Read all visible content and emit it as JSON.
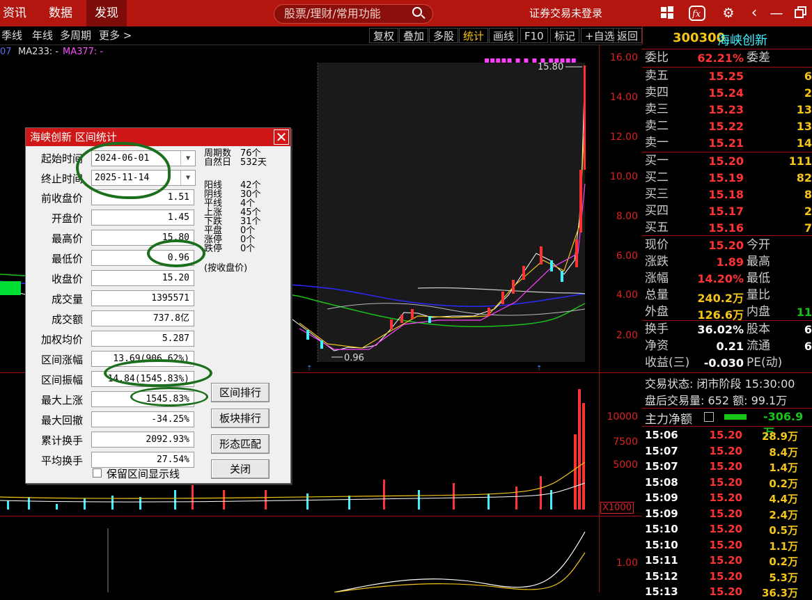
{
  "topbar": {
    "menus": [
      "资讯",
      "数据",
      "发现"
    ],
    "search_placeholder": "股票/理财/常用功能",
    "login_status": "证券交易未登录",
    "icons": [
      "windows-icon",
      "fx-icon",
      "gear-icon",
      "back-icon",
      "minimize-icon",
      "restore-icon"
    ]
  },
  "toolbar": {
    "periods": [
      "季线",
      "年线",
      "多周期",
      "更多 >"
    ],
    "buttons": [
      "复权",
      "叠加",
      "多股",
      "统计",
      "画线",
      "F10",
      "标记",
      "+自选",
      "返回"
    ],
    "ma_legend": [
      "07",
      "MA233: -",
      "MA377: -"
    ]
  },
  "chart": {
    "price_axis": [
      "16.00",
      "14.00",
      "12.00",
      "10.00",
      "8.00",
      "6.00",
      "4.00",
      "2.00"
    ],
    "high_label": "15.80",
    "low_label": "0.96",
    "volume_axis": [
      "10000",
      "7500",
      "5000"
    ],
    "volume_unit": "X1000",
    "indicator_axis": [
      "1.00"
    ]
  },
  "dialog": {
    "title": "海峡创新 区间统计",
    "start_label": "起始时间",
    "start_value": "2024-06-01",
    "end_label": "终止时间",
    "end_value": "2025-11-14",
    "rows": [
      {
        "label": "前收盘价",
        "value": "1.51"
      },
      {
        "label": "开盘价",
        "value": "1.45"
      },
      {
        "label": "最高价",
        "value": "15.80"
      },
      {
        "label": "最低价",
        "value": "0.96"
      },
      {
        "label": "收盘价",
        "value": "15.20"
      },
      {
        "label": "成交量",
        "value": "1395571"
      },
      {
        "label": "成交额",
        "value": "737.8亿"
      },
      {
        "label": "加权均价",
        "value": "5.287"
      },
      {
        "label": "区间涨幅",
        "value": "13.69(906.62%)"
      },
      {
        "label": "区间振幅",
        "value": "14.84(1545.83%)"
      },
      {
        "label": "最大上涨",
        "value": "1545.83%"
      },
      {
        "label": "最大回撤",
        "value": "-34.25%"
      },
      {
        "label": "累计换手",
        "value": "2092.93%"
      },
      {
        "label": "平均换手",
        "value": "27.54%"
      }
    ],
    "stats": [
      {
        "k": "周期数",
        "v": "76个"
      },
      {
        "k": "自然日",
        "v": "532天"
      },
      {
        "k": "阳线",
        "v": "42个"
      },
      {
        "k": "阴线",
        "v": "30个"
      },
      {
        "k": "平线",
        "v": "4个"
      },
      {
        "k": "上涨",
        "v": "45个"
      },
      {
        "k": "下跌",
        "v": "31个"
      },
      {
        "k": "平盘",
        "v": "0个"
      },
      {
        "k": "涨停",
        "v": "0个"
      },
      {
        "k": "跌停",
        "v": "0个"
      }
    ],
    "stats_note": "(按收盘价)",
    "buttons": [
      "区间排行",
      "板块排行",
      "形态匹配",
      "关闭"
    ],
    "checkbox_label": "保留区间显示线"
  },
  "quote": {
    "code": "300300",
    "name": "海峡创新",
    "ratio_label": "委比",
    "ratio_value": "62.21%",
    "diff_label": "委差",
    "asks": [
      {
        "label": "卖五",
        "price": "15.25",
        "vol": "6"
      },
      {
        "label": "卖四",
        "price": "15.24",
        "vol": "2"
      },
      {
        "label": "卖三",
        "price": "15.23",
        "vol": "13"
      },
      {
        "label": "卖二",
        "price": "15.22",
        "vol": "13"
      },
      {
        "label": "卖一",
        "price": "15.21",
        "vol": "14"
      }
    ],
    "bids": [
      {
        "label": "买一",
        "price": "15.20",
        "vol": "111"
      },
      {
        "label": "买二",
        "price": "15.19",
        "vol": "82"
      },
      {
        "label": "买三",
        "price": "15.18",
        "vol": "8"
      },
      {
        "label": "买四",
        "price": "15.17",
        "vol": "2"
      },
      {
        "label": "买五",
        "price": "15.16",
        "vol": "7"
      }
    ],
    "stats": [
      {
        "k": "现价",
        "v": "15.20",
        "k2": "今开"
      },
      {
        "k": "涨跌",
        "v": "1.89",
        "k2": "最高"
      },
      {
        "k": "涨幅",
        "v": "14.20%",
        "k2": "最低"
      },
      {
        "k": "总量",
        "v": "240.2万",
        "k2": "量比"
      },
      {
        "k": "外盘",
        "v": "126.6万",
        "k2": "内盘",
        "v2": "11"
      }
    ],
    "stats2": [
      {
        "k": "换手",
        "v": "36.02%",
        "k2": "股本",
        "v2": "6"
      },
      {
        "k": "净资",
        "v": "0.21",
        "k2": "流通",
        "v2": "6"
      },
      {
        "k": "收益(三)",
        "v": "-0.030",
        "k2": "PE(动)"
      }
    ],
    "trade_status": "交易状态: 闭市阶段 15:30:00",
    "after_hours": "盘后交易量: 652  额: 99.1万",
    "mainflow_label": "主力净额",
    "mainflow_value": "-306.9万",
    "ticks": [
      {
        "t": "15:06",
        "p": "15.20",
        "v": "28.9万"
      },
      {
        "t": "15:07",
        "p": "15.20",
        "v": "8.4万"
      },
      {
        "t": "15:07",
        "p": "15.20",
        "v": "1.4万"
      },
      {
        "t": "15:08",
        "p": "15.20",
        "v": "0.2万"
      },
      {
        "t": "15:09",
        "p": "15.20",
        "v": "4.4万"
      },
      {
        "t": "15:09",
        "p": "15.20",
        "v": "2.4万"
      },
      {
        "t": "15:10",
        "p": "15.20",
        "v": "0.5万"
      },
      {
        "t": "15:10",
        "p": "15.20",
        "v": "1.1万"
      },
      {
        "t": "15:11",
        "p": "15.20",
        "v": "0.2万"
      },
      {
        "t": "15:12",
        "p": "15.20",
        "v": "5.3万"
      },
      {
        "t": "15:13",
        "p": "15.20",
        "v": "36.3万"
      }
    ]
  }
}
